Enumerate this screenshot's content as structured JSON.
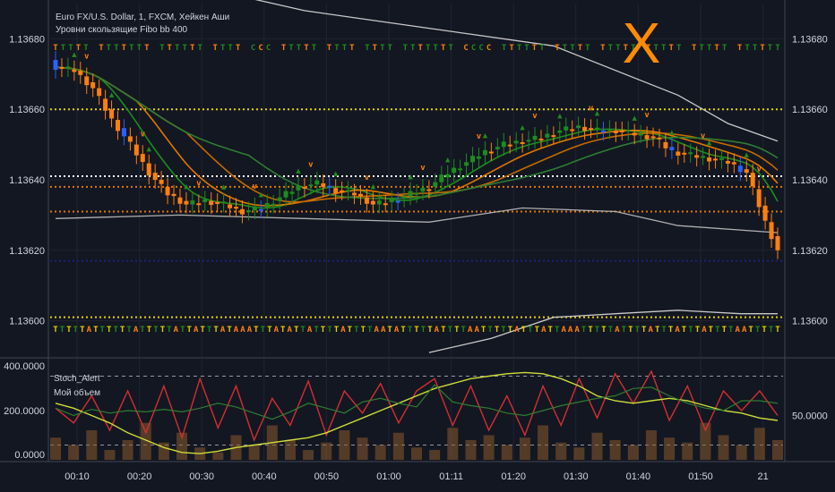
{
  "header": {
    "title": "Euro FX/U.S. Dollar, 1, FXCM, Хейкен Аши",
    "subtitle": "Уровни скользящие Fibo bb 400"
  },
  "overlay_mark": "X",
  "colors": {
    "background": "#131722",
    "bull": "#1e8c1e",
    "bear": "#ff7f0e",
    "blue": "#2962ff",
    "level_yellow": "#e6d200",
    "level_orange": "#e07800",
    "level_white": "#ffffff",
    "stoch_red": "#d32f2f",
    "stoch_green": "#2e7d32",
    "volume": "#8b5a2b"
  },
  "icons": {
    "signal_arrows": [
      "up-triangle-icon",
      "down-chevron-icon"
    ]
  },
  "chart_data": [
    {
      "type": "candlestick",
      "title": "Euro FX/U.S. Dollar, 1, FXCM, Хейкен Аши",
      "subtitle": "Уровни скользящие Fibo bb 400",
      "ylim": [
        1.1359,
        1.1369
      ],
      "y_ticks": [
        "1.13680",
        "1.13660",
        "1.13640",
        "1.13620",
        "1.13600"
      ],
      "x_ticks": [
        "00:10",
        "00:20",
        "00:30",
        "00:40",
        "00:50",
        "01:00",
        "01:11",
        "01:20",
        "01:30",
        "01:40",
        "01:50",
        "21"
      ],
      "levels": [
        {
          "value": 1.1366,
          "color": "#e6d200"
        },
        {
          "value": 1.13641,
          "color": "#ffffff"
        },
        {
          "value": 1.13638,
          "color": "#e07800"
        },
        {
          "value": 1.13631,
          "color": "#e07800"
        },
        {
          "value": 1.13617,
          "color": "#1a237e"
        },
        {
          "value": 1.13601,
          "color": "#e6d200"
        }
      ],
      "close_path": [
        [
          0,
          1.13672
        ],
        [
          3,
          1.13671
        ],
        [
          6,
          1.13666
        ],
        [
          9,
          1.13657
        ],
        [
          12,
          1.1365
        ],
        [
          15,
          1.13642
        ],
        [
          18,
          1.13636
        ],
        [
          21,
          1.13633
        ],
        [
          24,
          1.13634
        ],
        [
          27,
          1.13633
        ],
        [
          30,
          1.13631
        ],
        [
          33,
          1.13632
        ],
        [
          36,
          1.13635
        ],
        [
          39,
          1.13638
        ],
        [
          42,
          1.13639
        ],
        [
          45,
          1.13637
        ],
        [
          48,
          1.13636
        ],
        [
          51,
          1.13633
        ],
        [
          54,
          1.13634
        ],
        [
          57,
          1.13636
        ],
        [
          60,
          1.13638
        ],
        [
          63,
          1.13642
        ],
        [
          66,
          1.13645
        ],
        [
          69,
          1.13648
        ],
        [
          72,
          1.1365
        ],
        [
          75,
          1.13651
        ],
        [
          78,
          1.13652
        ],
        [
          81,
          1.13654
        ],
        [
          84,
          1.13655
        ],
        [
          87,
          1.13654
        ],
        [
          90,
          1.13654
        ],
        [
          93,
          1.13653
        ],
        [
          96,
          1.13652
        ],
        [
          99,
          1.13648
        ],
        [
          102,
          1.13647
        ],
        [
          105,
          1.13646
        ],
        [
          108,
          1.13645
        ],
        [
          111,
          1.13642
        ],
        [
          114,
          1.13628
        ],
        [
          116,
          1.1362
        ]
      ],
      "bb_upper": [
        [
          0,
          1.13705
        ],
        [
          20,
          1.13696
        ],
        [
          40,
          1.13688
        ],
        [
          60,
          1.13683
        ],
        [
          80,
          1.13678
        ],
        [
          100,
          1.13664
        ],
        [
          108,
          1.13656
        ],
        [
          116,
          1.13651
        ]
      ],
      "bb_mid": [
        [
          0,
          1.13629
        ],
        [
          20,
          1.1363
        ],
        [
          40,
          1.13629
        ],
        [
          60,
          1.13628
        ],
        [
          75,
          1.13632
        ],
        [
          90,
          1.13631
        ],
        [
          100,
          1.13627
        ],
        [
          116,
          1.13625
        ]
      ],
      "bb_lower": [
        [
          60,
          1.13591
        ],
        [
          70,
          1.13595
        ],
        [
          80,
          1.13601
        ],
        [
          90,
          1.13602
        ],
        [
          100,
          1.13603
        ],
        [
          110,
          1.13602
        ],
        [
          116,
          1.13602
        ]
      ],
      "signal_row_top": "TTTTT TTTTTTT TTTTTT TTTT CCC TTTTT TTTT TTTT TTTTTTT CCCC TTTTTT TTTTT TTTTT TTTTT TTTTT TTTTTT",
      "signal_row_bottom": "TTTTTATTTTTTATTTTTATTATTTATAAATTTATATTATTTTATTTTAATATTTTTATTTTAATTTTTATTTATTAAATTTTTATTTTATTTATTTATTTTAATTTTT"
    },
    {
      "type": "line",
      "name": "Stoch_Alert",
      "legend": [
        "Stoch_Alert",
        "Мой объем"
      ],
      "ylim": [
        0,
        400
      ],
      "y_ticks_left": [
        "400.0000",
        "200.0000",
        "0.0000"
      ],
      "y_ticks_right": [
        "50.0000"
      ],
      "bands": [
        340,
        60
      ],
      "series": [
        {
          "name": "Stoch_Alert",
          "values": [
            210,
            150,
            260,
            120,
            280,
            110,
            300,
            90,
            330,
            130,
            300,
            80,
            250,
            140,
            320,
            100,
            280,
            190,
            310,
            150,
            280,
            330,
            140,
            300,
            120,
            260,
            100,
            300,
            140,
            330,
            170,
            350,
            230,
            360,
            160,
            300,
            120,
            280,
            200,
            280,
            180
          ]
        },
        {
          "name": "Мой объем",
          "values": [
            230,
            210,
            180,
            150,
            110,
            80,
            50,
            30,
            25,
            35,
            50,
            60,
            70,
            80,
            90,
            110,
            140,
            170,
            200,
            230,
            260,
            290,
            310,
            330,
            340,
            350,
            355,
            350,
            330,
            300,
            260,
            240,
            230,
            240,
            250,
            240,
            220,
            200,
            190,
            170,
            160
          ]
        }
      ],
      "volume": [
        90,
        60,
        120,
        40,
        80,
        150,
        70,
        110,
        50,
        30,
        100,
        60,
        140,
        80,
        40,
        70,
        120,
        90,
        60,
        110,
        50,
        40,
        130,
        80,
        100,
        60,
        90,
        140,
        70,
        50,
        110,
        80,
        60,
        120,
        90,
        70,
        150,
        100,
        60,
        130,
        80
      ]
    }
  ]
}
